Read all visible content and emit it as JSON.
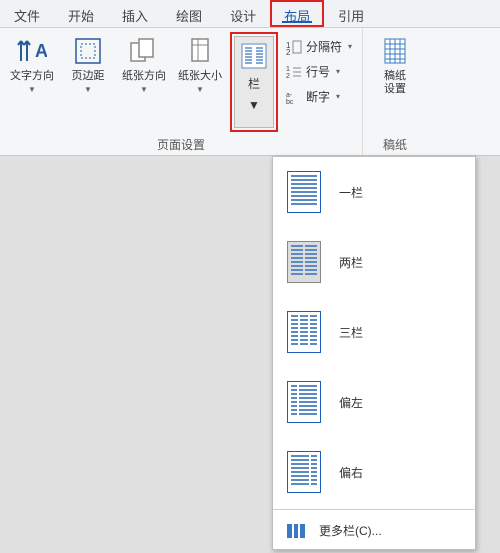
{
  "tabs": {
    "file": "文件",
    "home": "开始",
    "insert": "插入",
    "draw": "绘图",
    "design": "设计",
    "layout": "布局",
    "refs": "引用"
  },
  "ribbon": {
    "page_setup_label": "页面设置",
    "text_dir": "文字方向",
    "margins": "页边距",
    "orientation": "纸张方向",
    "size": "纸张大小",
    "columns": "栏",
    "breaks": "分隔符",
    "line_no": "行号",
    "hyphen": "断字",
    "grid_label": "稿纸",
    "grid_settings": "稿纸设置",
    "grid_settings_l1": "稿纸",
    "grid_settings_l2": "设置"
  },
  "dropdown": {
    "one": "一栏",
    "two": "两栏",
    "three": "三栏",
    "left": "偏左",
    "right": "偏右",
    "more": "更多栏(C)..."
  }
}
